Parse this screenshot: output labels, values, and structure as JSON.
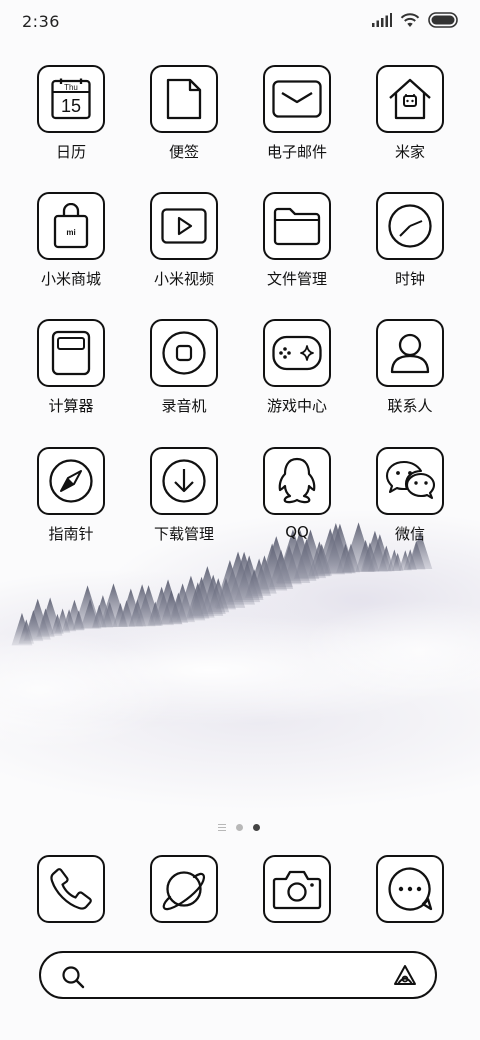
{
  "status_bar": {
    "time": "2:36",
    "icons": [
      "signal-icon",
      "wifi-icon",
      "battery-icon"
    ]
  },
  "apps": [
    {
      "name": "日历",
      "icon": "calendar-icon",
      "calendar_day": "Thu",
      "calendar_date": "15"
    },
    {
      "name": "便签",
      "icon": "notes-icon"
    },
    {
      "name": "电子邮件",
      "icon": "email-icon"
    },
    {
      "name": "米家",
      "icon": "mi-home-icon"
    },
    {
      "name": "小米商城",
      "icon": "mi-store-icon",
      "badge": "mi"
    },
    {
      "name": "小米视频",
      "icon": "video-icon"
    },
    {
      "name": "文件管理",
      "icon": "folder-icon"
    },
    {
      "name": "时钟",
      "icon": "clock-icon"
    },
    {
      "name": "计算器",
      "icon": "calculator-icon"
    },
    {
      "name": "录音机",
      "icon": "recorder-icon"
    },
    {
      "name": "游戏中心",
      "icon": "gamepad-icon"
    },
    {
      "name": "联系人",
      "icon": "contacts-icon"
    },
    {
      "name": "指南针",
      "icon": "compass-icon"
    },
    {
      "name": "下载管理",
      "icon": "download-icon"
    },
    {
      "name": "QQ",
      "icon": "qq-icon"
    },
    {
      "name": "微信",
      "icon": "wechat-icon"
    }
  ],
  "page_indicator": {
    "pages": 3,
    "current": 3
  },
  "dock": [
    {
      "icon": "phone-icon"
    },
    {
      "icon": "browser-icon"
    },
    {
      "icon": "camera-icon"
    },
    {
      "icon": "messages-icon"
    }
  ],
  "search_bar": {
    "left_icon": "search-icon",
    "right_icon": "assistant-icon"
  },
  "colors": {
    "stroke": "#111111",
    "background": "#ffffff",
    "indicator_active": "#444444",
    "indicator_inactive": "#b8b8b8"
  }
}
